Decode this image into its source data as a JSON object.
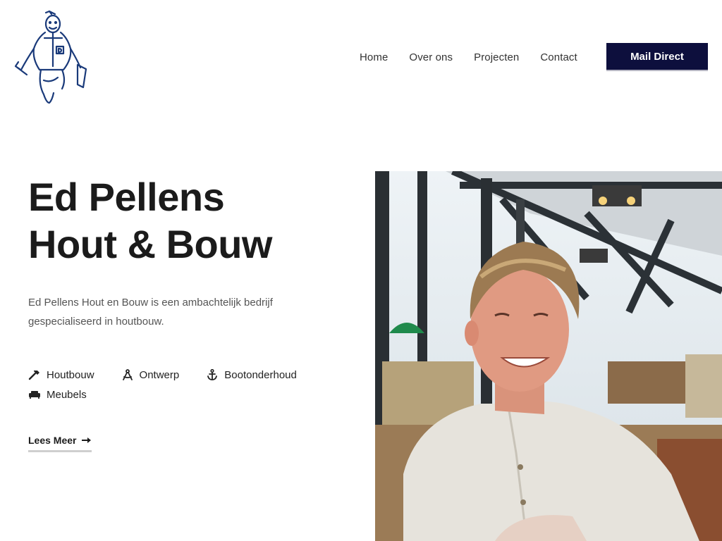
{
  "brand": {
    "logo": "carpenter-mascot"
  },
  "nav": {
    "items": [
      {
        "label": "Home"
      },
      {
        "label": "Over ons"
      },
      {
        "label": "Projecten"
      },
      {
        "label": "Contact"
      }
    ],
    "cta_label": "Mail Direct"
  },
  "hero": {
    "title_line1": "Ed Pellens",
    "title_line2": "Hout & Bouw",
    "description": "Ed Pellens Hout en Bouw is een ambachtelijk bedrijf gespecialiseerd in houtbouw.",
    "services": [
      {
        "label": "Houtbouw",
        "icon": "hammer-icon"
      },
      {
        "label": "Ontwerp",
        "icon": "compass-icon"
      },
      {
        "label": "Bootonderhoud",
        "icon": "anchor-icon"
      },
      {
        "label": "Meubels",
        "icon": "couch-icon"
      }
    ],
    "read_more_label": "Lees Meer"
  },
  "colors": {
    "primary_button": "#0d0f3d",
    "logo_stroke": "#1a3a7a",
    "text_dark": "#1b1b1b"
  }
}
